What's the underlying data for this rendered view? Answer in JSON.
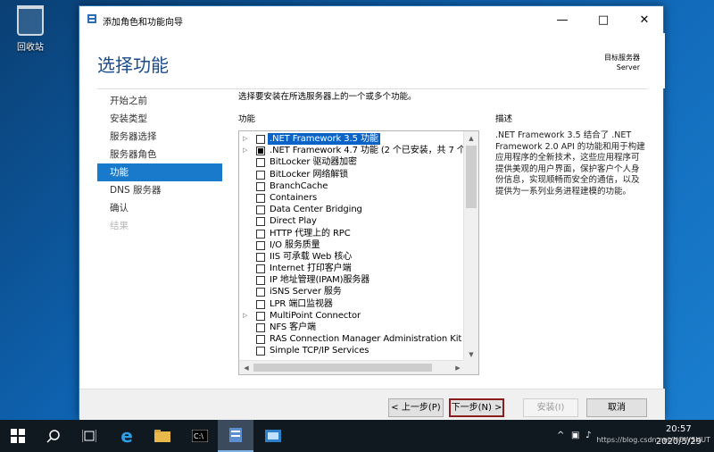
{
  "desktop": {
    "recycle_bin_label": "回收站"
  },
  "window": {
    "title": "添加角色和功能向导",
    "heading": "选择功能",
    "destination_label": "目标服务器",
    "destination_value": "Server"
  },
  "nav": {
    "items": [
      {
        "label": "开始之前"
      },
      {
        "label": "安装类型"
      },
      {
        "label": "服务器选择"
      },
      {
        "label": "服务器角色"
      },
      {
        "label": "功能"
      },
      {
        "label": "DNS 服务器"
      },
      {
        "label": "确认"
      },
      {
        "label": "结果"
      }
    ]
  },
  "main": {
    "instruction": "选择要安装在所选服务器上的一个或多个功能。",
    "features_label": "功能",
    "description_label": "描述",
    "description_text": ".NET Framework 3.5 结合了 .NET Framework 2.0 API 的功能和用于构建应用程序的全新技术，这些应用程序可提供美观的用户界面，保护客户个人身份信息，实现顺畅而安全的通信，以及提供为一系列业务进程建模的功能。",
    "features": [
      {
        "label": ".NET Framework 3.5 功能"
      },
      {
        "label": ".NET Framework 4.7 功能 (2 个已安装，共 7 个)"
      },
      {
        "label": "BitLocker 驱动器加密"
      },
      {
        "label": "BitLocker 网络解锁"
      },
      {
        "label": "BranchCache"
      },
      {
        "label": "Containers"
      },
      {
        "label": "Data Center Bridging"
      },
      {
        "label": "Direct Play"
      },
      {
        "label": "HTTP 代理上的 RPC"
      },
      {
        "label": "I/O 服务质量"
      },
      {
        "label": "IIS 可承载 Web 核心"
      },
      {
        "label": "Internet 打印客户端"
      },
      {
        "label": "IP 地址管理(IPAM)服务器"
      },
      {
        "label": "iSNS Server 服务"
      },
      {
        "label": "LPR 端口监视器"
      },
      {
        "label": "MultiPoint Connector"
      },
      {
        "label": "NFS 客户端"
      },
      {
        "label": "RAS Connection Manager Administration Kit (C"
      },
      {
        "label": "Simple TCP/IP Services"
      }
    ]
  },
  "footer": {
    "prev_label": "< 上一步(P)",
    "next_label": "下一步(N) >",
    "install_label": "安装(I)",
    "cancel_label": "取消"
  },
  "taskbar": {
    "time": "20:57",
    "date": "2020/5/29",
    "watermark": "https://blog.csdn.net/NOWSHUT"
  }
}
